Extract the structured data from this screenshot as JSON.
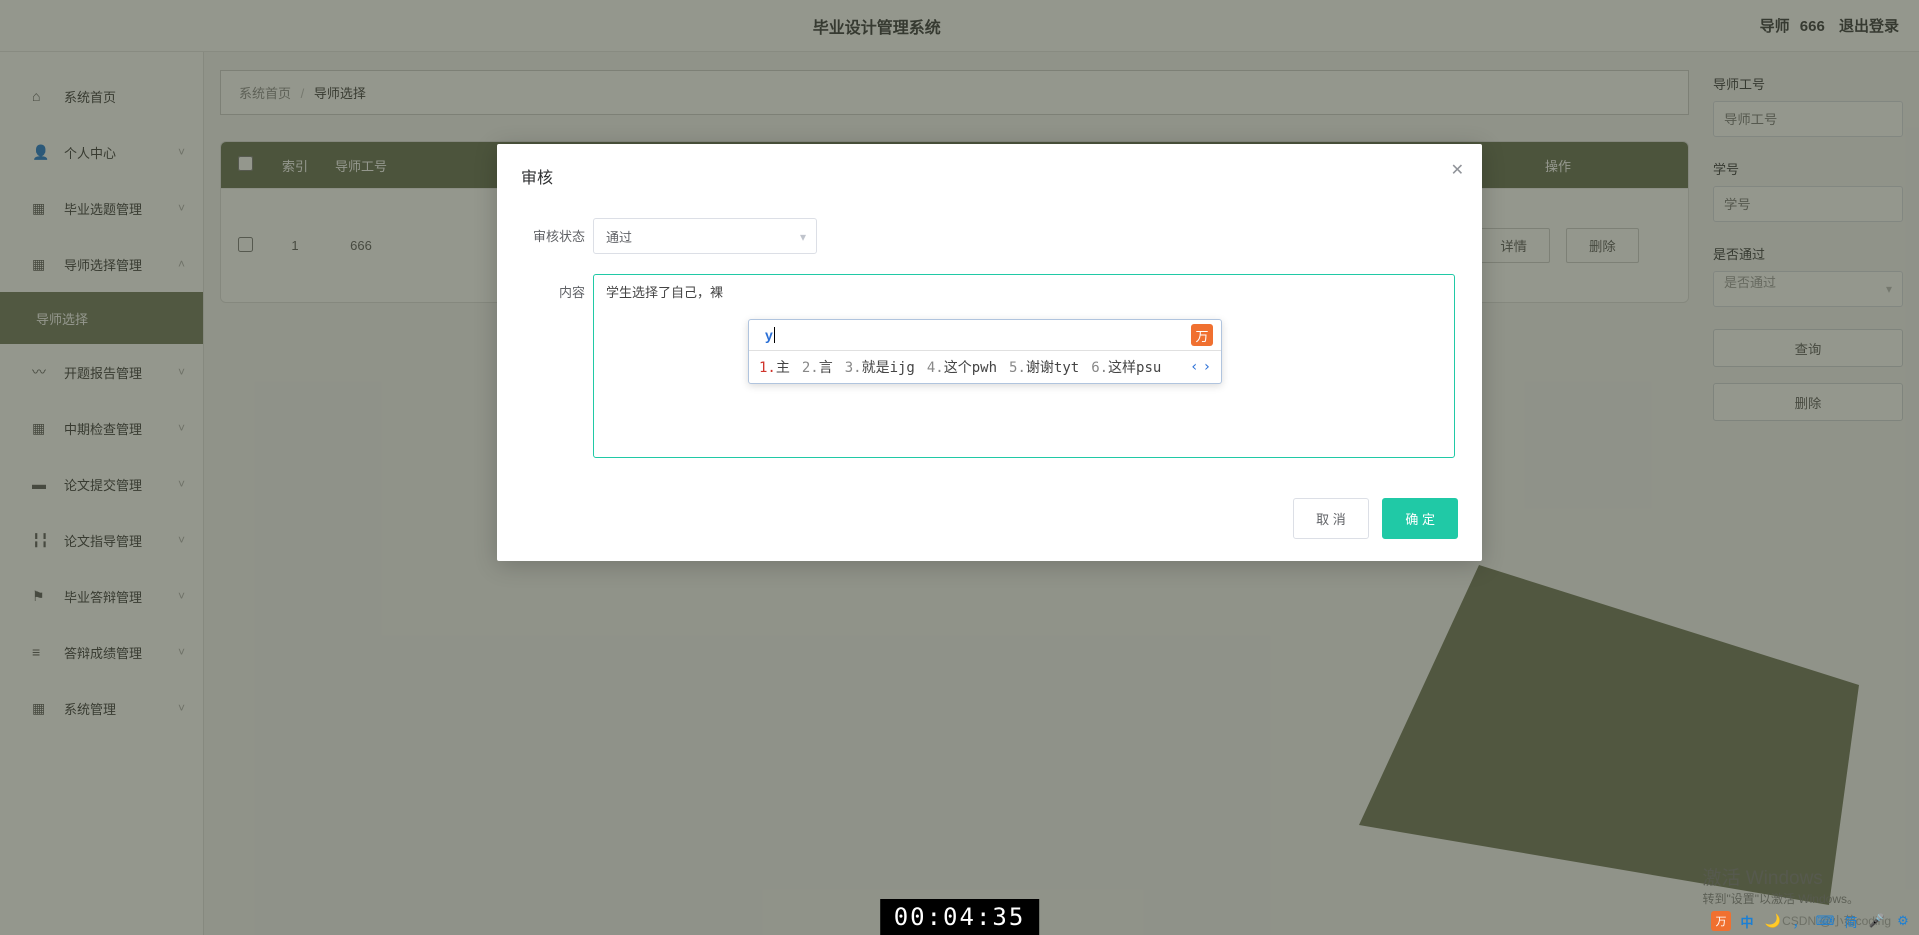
{
  "header": {
    "title": "毕业设计管理系统",
    "role": "导师",
    "username": "666",
    "logout": "退出登录"
  },
  "sidebar": {
    "items": [
      {
        "icon": "⌂",
        "label": "系统首页",
        "expandable": false
      },
      {
        "icon": "👤",
        "label": "个人中心",
        "expandable": true
      },
      {
        "icon": "▦",
        "label": "毕业选题管理",
        "expandable": true
      },
      {
        "icon": "▦",
        "label": "导师选择管理",
        "expandable": true,
        "expanded": true,
        "sub": "导师选择"
      },
      {
        "icon": "〰",
        "label": "开题报告管理",
        "expandable": true
      },
      {
        "icon": "▦",
        "label": "中期检查管理",
        "expandable": true
      },
      {
        "icon": "▬",
        "label": "论文提交管理",
        "expandable": true
      },
      {
        "icon": "╏╏",
        "label": "论文指导管理",
        "expandable": true
      },
      {
        "icon": "⚑",
        "label": "毕业答辩管理",
        "expandable": true
      },
      {
        "icon": "≡",
        "label": "答辩成绩管理",
        "expandable": true
      },
      {
        "icon": "▦",
        "label": "系统管理",
        "expandable": true
      }
    ]
  },
  "breadcrumb": {
    "home": "系统首页",
    "current": "导师选择"
  },
  "table": {
    "headers": {
      "index": "索引",
      "teacher_id": "导师工号",
      "ops": "操作"
    },
    "rows": [
      {
        "index": "1",
        "teacher_id": "666"
      }
    ],
    "row_buttons": {
      "detail": "详情",
      "delete": "删除"
    }
  },
  "filter": {
    "teacher_id_label": "导师工号",
    "teacher_id_placeholder": "导师工号",
    "student_id_label": "学号",
    "student_id_placeholder": "学号",
    "pass_label": "是否通过",
    "pass_placeholder": "是否通过",
    "query": "查询",
    "delete": "删除"
  },
  "dialog": {
    "title": "审核",
    "status_label": "审核状态",
    "status_value": "通过",
    "content_label": "内容",
    "content_value": "学生选择了自己，裸",
    "cancel": "取 消",
    "ok": "确 定"
  },
  "ime": {
    "input": "y",
    "candidates": [
      {
        "n": "1.",
        "txt": "主"
      },
      {
        "n": "2.",
        "txt": "言"
      },
      {
        "n": "3.",
        "txt": "就是ijg"
      },
      {
        "n": "4.",
        "txt": "这个pwh"
      },
      {
        "n": "5.",
        "txt": "谢谢tyt"
      },
      {
        "n": "6.",
        "txt": "这样psu"
      }
    ]
  },
  "activation": {
    "line1": "激活 Windows",
    "line2": "转到\"设置\"以激活 Windows。"
  },
  "watermark": "CSDN @小茹coding",
  "timer": "00:04:35",
  "tray": {
    "cn": "中",
    "comma": "，",
    "full": "简"
  }
}
